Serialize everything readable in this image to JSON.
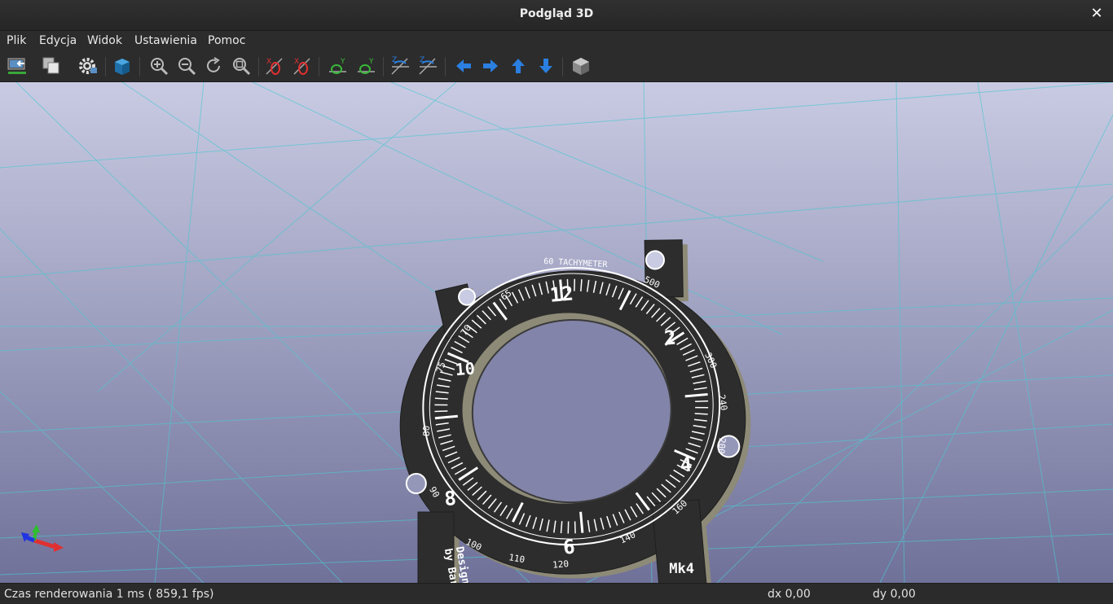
{
  "window": {
    "title": "Podgląd 3D",
    "close_glyph": "✕"
  },
  "menu": [
    "Plik",
    "Edycja",
    "Widok",
    "Ustawienia",
    "Pomoc"
  ],
  "toolbar": [
    "reload-board-icon",
    "copy-image-icon",
    "settings-gear-icon",
    "render-cube-icon",
    "zoom-in-icon",
    "zoom-out-icon",
    "redraw-icon",
    "zoom-fit-icon",
    "rotate-x-cw-icon",
    "rotate-x-ccw-icon",
    "rotate-y-cw-icon",
    "rotate-y-ccw-icon",
    "rotate-z-cw-icon",
    "rotate-z-ccw-icon",
    "move-left-icon",
    "move-right-icon",
    "move-up-icon",
    "move-down-icon",
    "home-view-icon"
  ],
  "model_text": {
    "tachymeter": "60 TACHYMETER",
    "numerals": [
      "12",
      "2",
      "4",
      "6",
      "8",
      "10"
    ],
    "scale_marks": [
      "500",
      "300",
      "240",
      "200",
      "160",
      "140",
      "120",
      "110",
      "100",
      "90",
      "80",
      "75",
      "70",
      "65"
    ],
    "lug_left": "Designed\nby Bart",
    "lug_right": "Mk4"
  },
  "status": {
    "render_time": "Czas renderowania 1 ms ( 859,1 fps)",
    "dx": "dx 0,00",
    "dy": "dy 0,00"
  },
  "colors": {
    "bg_top": "#c9cbe3",
    "bg_bottom": "#6f7199",
    "grid": "#4fc6d0",
    "board": "#2d2d2d",
    "board_edge": "#8d8a77",
    "silk": "#ffffff",
    "toolbar_blue": "#2a7fe0"
  }
}
